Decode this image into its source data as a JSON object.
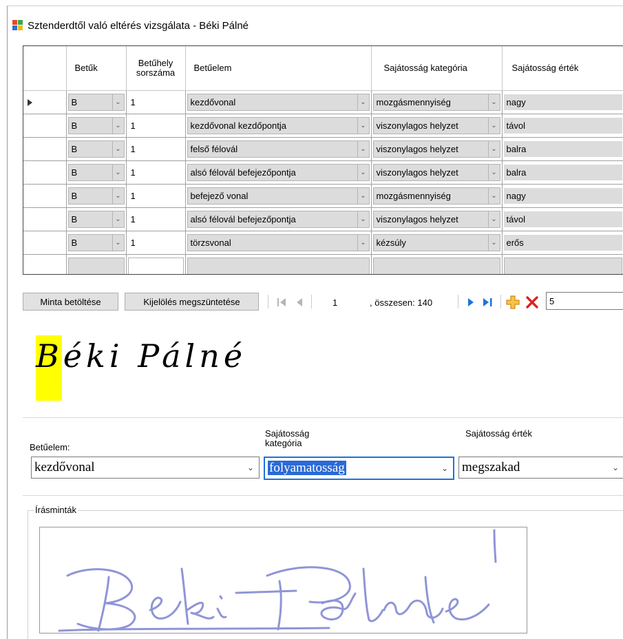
{
  "window": {
    "title": "Sztenderdtől való eltérés vizsgálata - Béki Pálné"
  },
  "grid": {
    "columns": [
      {
        "label": "Betűk"
      },
      {
        "label": "Betűhely sorszáma"
      },
      {
        "label": "Betűelem"
      },
      {
        "label": "Sajátosság kategória"
      },
      {
        "label": "Sajátosság érték"
      }
    ],
    "rows": [
      {
        "letter": "B",
        "position": "1",
        "element": "kezdővonal",
        "category": "mozgásmennyiség",
        "value": "nagy"
      },
      {
        "letter": "B",
        "position": "1",
        "element": "kezdővonal kezdőpontja",
        "category": "viszonylagos helyzet",
        "value": "távol"
      },
      {
        "letter": "B",
        "position": "1",
        "element": "felső félovál",
        "category": "viszonylagos helyzet",
        "value": "balra"
      },
      {
        "letter": "B",
        "position": "1",
        "element": "alsó félovál befejezőpontja",
        "category": "viszonylagos helyzet",
        "value": "balra"
      },
      {
        "letter": "B",
        "position": "1",
        "element": "befejező vonal",
        "category": "mozgásmennyiség",
        "value": "nagy"
      },
      {
        "letter": "B",
        "position": "1",
        "element": "alsó félovál befejezőpontja",
        "category": "viszonylagos helyzet",
        "value": "távol"
      },
      {
        "letter": "B",
        "position": "1",
        "element": "törzsvonal",
        "category": "kézsúly",
        "value": "erős"
      }
    ]
  },
  "toolbar": {
    "load_sample": "Minta betöltése",
    "clear_selection": "Kijelölés megszüntetése",
    "current_page": "1",
    "total_text": ", összesen: 140",
    "count_value": "5"
  },
  "sample_text": "Béki Pálné",
  "form": {
    "element_label": "Betűelem:",
    "element_value": "kezdővonal",
    "category_label": "Sajátosság kategória",
    "category_value": "folyamatosság",
    "value_label": "Sajátosság érték",
    "value_value": "megszakad"
  },
  "writing_samples": {
    "label": "Írásminták"
  },
  "colors": {
    "highlight": "#ffff00",
    "selection": "#2a6ad6",
    "nav_blue": "#1e73d8",
    "add_orange": "#f0a020",
    "delete_red": "#e02020",
    "ink": "#8f95d6"
  }
}
